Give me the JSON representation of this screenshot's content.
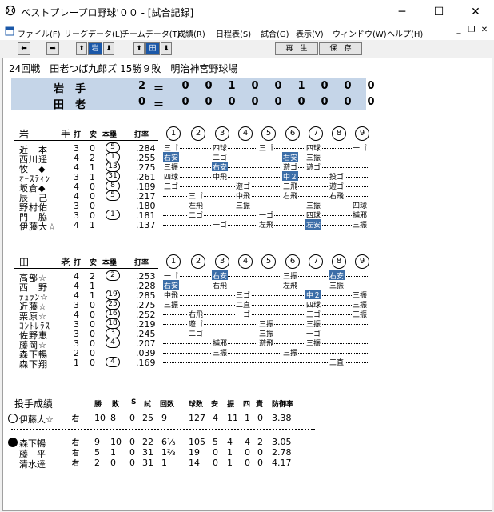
{
  "window": {
    "title": "ベストプレープロ野球'００ - [試合記録]",
    "minimize": "─",
    "maximize": "☐",
    "close": "✕"
  },
  "menu": [
    {
      "label": "ファイル(F)"
    },
    {
      "label": "リーグデータ(L)"
    },
    {
      "label": "チームデータ(T)"
    },
    {
      "label": "成績(R)"
    },
    {
      "label": "日程表(S)"
    },
    {
      "label": "試合(G)"
    },
    {
      "label": "表示(V)"
    },
    {
      "label": "ウィンドウ(W)"
    },
    {
      "label": "ヘルプ(H)"
    }
  ],
  "toolbar": {
    "team1": "岩",
    "team2": "田",
    "replay": "再　生",
    "save": "保　存"
  },
  "game": {
    "title": "24回戦　田老つば九郎ズ 15勝９敗　明治神宮野球場"
  },
  "scoreboard": [
    {
      "team": "岩手",
      "total": "2",
      "eq": "＝",
      "innings": [
        "0",
        "0",
        "1",
        "0",
        "0",
        "1",
        "0",
        "0",
        "0"
      ]
    },
    {
      "team": "田老",
      "total": "0",
      "eq": "＝",
      "innings": [
        "0",
        "0",
        "0",
        "0",
        "0",
        "0",
        "0",
        "0",
        "0"
      ]
    }
  ],
  "batting_headers": {
    "h1": "打",
    "h2": "安",
    "h3": "本塁",
    "h4": "打率"
  },
  "innings_labels": [
    "1",
    "2",
    "3",
    "4",
    "5",
    "6",
    "7",
    "8",
    "9"
  ],
  "team1": {
    "name": "岩　手",
    "batters": [
      {
        "name": "近　本",
        "ab": "3",
        "h": "0",
        "hr": "5",
        "avg": ".284",
        "res": [
          "三ゴ",
          "",
          "四球",
          "",
          "三ゴ",
          "",
          "四球",
          "",
          "一ゴ"
        ],
        "hl": []
      },
      {
        "name": "西川遥",
        "ab": "4",
        "h": "2",
        "hr": "1",
        "avg": ".255",
        "res": [
          "右安",
          "",
          "二ゴ",
          "",
          "",
          "右安",
          "三振",
          "",
          ""
        ],
        "hl": [
          0,
          5
        ]
      },
      {
        "name": "牧　◆",
        "ab": "4",
        "h": "1",
        "hr": "13",
        "avg": ".275",
        "res": [
          "三振",
          "",
          "右安",
          "",
          "",
          "遊ゴ",
          "遊ゴ",
          "",
          ""
        ],
        "hl": [
          2
        ]
      },
      {
        "name": "ｵｰｽﾃｨﾝ",
        "ab": "3",
        "h": "1",
        "hr": "31",
        "avg": ".261",
        "res": [
          "四球",
          "",
          "中飛",
          "",
          "",
          "中２",
          "",
          "投ゴ",
          ""
        ],
        "hl": [
          5
        ]
      },
      {
        "name": "坂倉◆",
        "ab": "4",
        "h": "0",
        "hr": "8",
        "avg": ".189",
        "res": [
          "三ゴ",
          "",
          "",
          "遊ゴ",
          "",
          "三飛",
          "",
          "遊ゴ",
          ""
        ],
        "hl": []
      },
      {
        "name": "辰　己",
        "ab": "4",
        "h": "0",
        "hr": "5",
        "avg": ".217",
        "res": [
          "",
          "三ゴ",
          "",
          "中飛",
          "",
          "右飛",
          "",
          "右飛",
          ""
        ],
        "hl": []
      },
      {
        "name": "野村佑",
        "ab": "3",
        "h": "0",
        "hr": "",
        "avg": ".180",
        "res": [
          "",
          "左飛",
          "",
          "三振",
          "",
          "",
          "三振",
          "",
          "四球"
        ],
        "hl": []
      },
      {
        "name": "門　脇",
        "ab": "3",
        "h": "0",
        "hr": "1",
        "avg": ".181",
        "res": [
          "",
          "二ゴ",
          "",
          "",
          "一ゴ",
          "",
          "四球",
          "",
          "捕邪"
        ],
        "hl": []
      },
      {
        "name": "伊藤大☆",
        "ab": "4",
        "h": "1",
        "hr": "",
        "avg": ".137",
        "res": [
          "",
          "",
          "一ゴ",
          "",
          "左飛",
          "",
          "左安",
          "",
          "三振"
        ],
        "hl": [
          6
        ]
      }
    ]
  },
  "team2": {
    "name": "田　老",
    "batters": [
      {
        "name": "高部☆",
        "ab": "4",
        "h": "2",
        "hr": "2",
        "avg": ".253",
        "res": [
          "一ゴ",
          "",
          "右安",
          "",
          "",
          "三振",
          "",
          "右安",
          ""
        ],
        "hl": [
          2,
          7
        ]
      },
      {
        "name": "西　野",
        "ab": "4",
        "h": "1",
        "hr": "",
        "avg": ".228",
        "res": [
          "右安",
          "",
          "右飛",
          "",
          "",
          "左飛",
          "",
          "三振",
          ""
        ],
        "hl": [
          0
        ]
      },
      {
        "name": "ﾃｭﾗﾝ☆",
        "ab": "4",
        "h": "1",
        "hr": "19",
        "avg": ".285",
        "res": [
          "中飛",
          "",
          "",
          "三ゴ",
          "",
          "",
          "中２",
          "",
          "三振"
        ],
        "hl": [
          6
        ]
      },
      {
        "name": "近藤☆",
        "ab": "3",
        "h": "0",
        "hr": "25",
        "avg": ".275",
        "res": [
          "三振",
          "",
          "",
          "二直",
          "",
          "",
          "四球",
          "",
          "三振"
        ],
        "hl": []
      },
      {
        "name": "栗原☆",
        "ab": "4",
        "h": "0",
        "hr": "16",
        "avg": ".252",
        "res": [
          "",
          "右飛",
          "",
          "一ゴ",
          "",
          "",
          "三ゴ",
          "",
          "三振"
        ],
        "hl": []
      },
      {
        "name": "ｺﾝﾄﾚﾗｽ",
        "ab": "3",
        "h": "0",
        "hr": "18",
        "avg": ".219",
        "res": [
          "",
          "遊ゴ",
          "",
          "",
          "三振",
          "",
          "三振",
          "",
          ""
        ],
        "hl": []
      },
      {
        "name": "佐野恵",
        "ab": "3",
        "h": "0",
        "hr": "3",
        "avg": ".245",
        "res": [
          "",
          "二ゴ",
          "",
          "",
          "三振",
          "",
          "一ゴ",
          "",
          ""
        ],
        "hl": []
      },
      {
        "name": "藤岡☆",
        "ab": "3",
        "h": "0",
        "hr": "4",
        "avg": ".207",
        "res": [
          "",
          "",
          "捕邪",
          "",
          "遊飛",
          "",
          "三振",
          "",
          ""
        ],
        "hl": []
      },
      {
        "name": "森下暢",
        "ab": "2",
        "h": "0",
        "hr": "",
        "avg": ".039",
        "res": [
          "",
          "",
          "三振",
          "",
          "",
          "三振",
          "",
          "",
          ""
        ],
        "hl": []
      },
      {
        "name": "森下翔",
        "ab": "1",
        "h": "0",
        "hr": "4",
        "avg": ".169",
        "res": [
          "",
          "",
          "",
          "",
          "",
          "",
          "",
          "三直",
          ""
        ],
        "hl": []
      }
    ]
  },
  "pitching": {
    "title": "投手成績",
    "headers": [
      "勝",
      "敗",
      "S",
      "試",
      "回数",
      "球数",
      "安",
      "振",
      "四",
      "責",
      "防御率"
    ],
    "rows": [
      {
        "group": 1,
        "mark": "勝",
        "name": "伊藤大☆",
        "hand": "右",
        "w": "10",
        "l": "8",
        "s": "0",
        "g": "25",
        "ip": "9",
        "np": "127",
        "h": "4",
        "k": "11",
        "bb": "1",
        "er": "0",
        "era": "3.38"
      },
      {
        "group": 2,
        "mark": "敗",
        "name": "森下暢",
        "hand": "右",
        "w": "9",
        "l": "10",
        "s": "0",
        "g": "22",
        "ip": "6⅓",
        "np": "105",
        "h": "5",
        "k": "4",
        "bb": "4",
        "er": "2",
        "era": "3.05"
      },
      {
        "group": 2,
        "mark": "",
        "name": "藤　平",
        "hand": "右",
        "w": "5",
        "l": "1",
        "s": "0",
        "g": "31",
        "ip": "1⅔",
        "np": "19",
        "h": "0",
        "k": "1",
        "bb": "0",
        "er": "0",
        "era": "2.78"
      },
      {
        "group": 2,
        "mark": "",
        "name": "清水達",
        "hand": "右",
        "w": "2",
        "l": "0",
        "s": "0",
        "g": "31",
        "ip": "1",
        "np": "14",
        "h": "0",
        "k": "1",
        "bb": "0",
        "er": "0",
        "era": "4.17"
      }
    ]
  }
}
